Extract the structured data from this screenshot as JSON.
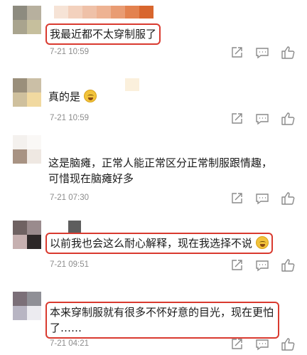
{
  "comments": [
    {
      "text": "我最近都不太穿制服了",
      "time": "7-21 10:59",
      "emoji": false
    },
    {
      "text": "真的是",
      "time": "7-21 10:59",
      "emoji": true
    },
    {
      "text_line1": "这是脑瘫，正常人能正常区分正常制服跟情趣，",
      "text_line2": "可惜现在脑瘫好多",
      "time": "7-21 07:30",
      "emoji": false
    },
    {
      "text": "以前我也会这么耐心解释，现在我选择不说",
      "time": "7-21 09:51",
      "emoji": true
    },
    {
      "text_line1": "本来穿制服就有很多不怀好意的目光，现在更怕",
      "text_line2": "了……",
      "time": "7-21 04:21",
      "emoji": false
    }
  ],
  "icons": [
    "share-icon",
    "comment-icon",
    "like-icon"
  ],
  "colors": {
    "highlight_border": "#d93a2f",
    "timestamp": "#8c8c8c",
    "icon": "#8a8a8a"
  }
}
